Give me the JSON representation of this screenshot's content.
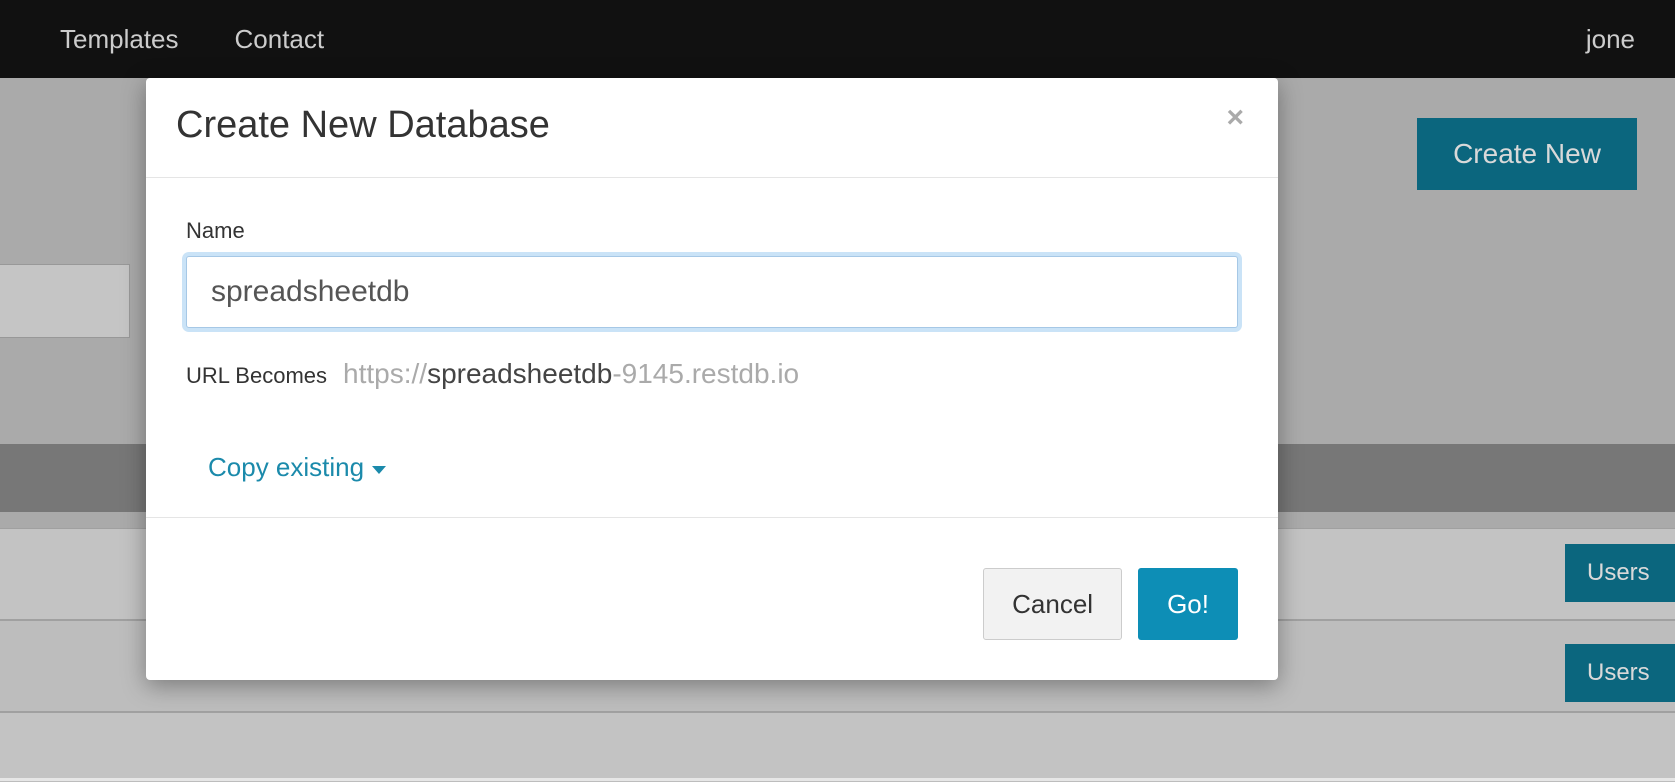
{
  "topbar": {
    "nav_templates": "Templates",
    "nav_contact": "Contact",
    "user": "jone"
  },
  "bg": {
    "create_new": "Create New",
    "users": "Users"
  },
  "modal": {
    "title": "Create New Database",
    "close_glyph": "×",
    "name_label": "Name",
    "name_value": "spreadsheetdb",
    "url_becomes_label": "URL Becomes",
    "url_prefix": "https://",
    "url_name": "spreadsheetdb",
    "url_suffix": "-9145.restdb.io",
    "copy_existing_label": "Copy existing",
    "cancel": "Cancel",
    "go": "Go!"
  }
}
